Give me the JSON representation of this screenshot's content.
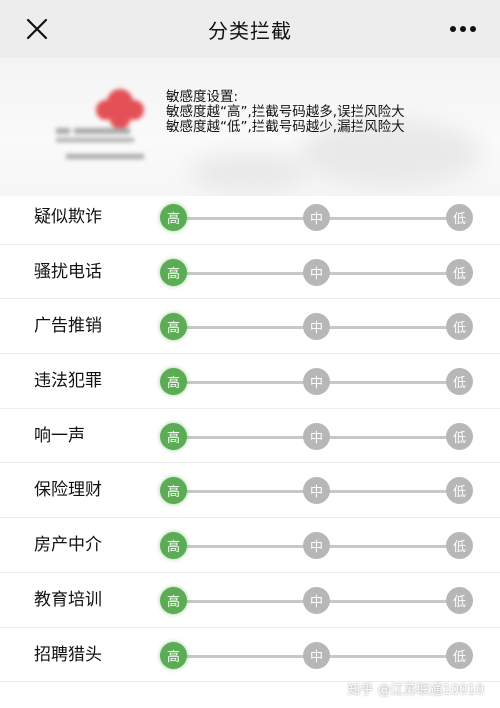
{
  "header": {
    "title": "分类拦截",
    "close_icon": "close-icon",
    "more_icon": "more-dots-icon"
  },
  "banner": {
    "logo_icon": "china-unicom-logo",
    "notice_lines": [
      "敏感度设置:",
      "敏感度越“高”,拦截号码越多,误拦风险大",
      "敏感度越“低”,拦截号码越少,漏拦风险大"
    ]
  },
  "categories": [
    {
      "label": "疑似欺诈",
      "level": "高"
    },
    {
      "label": "骚扰电话",
      "level": "高"
    },
    {
      "label": "广告推销",
      "level": "高"
    },
    {
      "label": "违法犯罪",
      "level": "高"
    },
    {
      "label": "响一声",
      "level": "高"
    },
    {
      "label": "保险理财",
      "level": "高"
    },
    {
      "label": "房产中介",
      "level": "高"
    },
    {
      "label": "教育培训",
      "level": "高"
    },
    {
      "label": "招聘猎头",
      "level": "高"
    }
  ],
  "levels": [
    "高",
    "中",
    "低"
  ],
  "colors": {
    "active": "#5cac56",
    "inactive": "#b7b7b7",
    "track": "#c8c8c8"
  },
  "watermark": "知乎 @江苏联通10010"
}
